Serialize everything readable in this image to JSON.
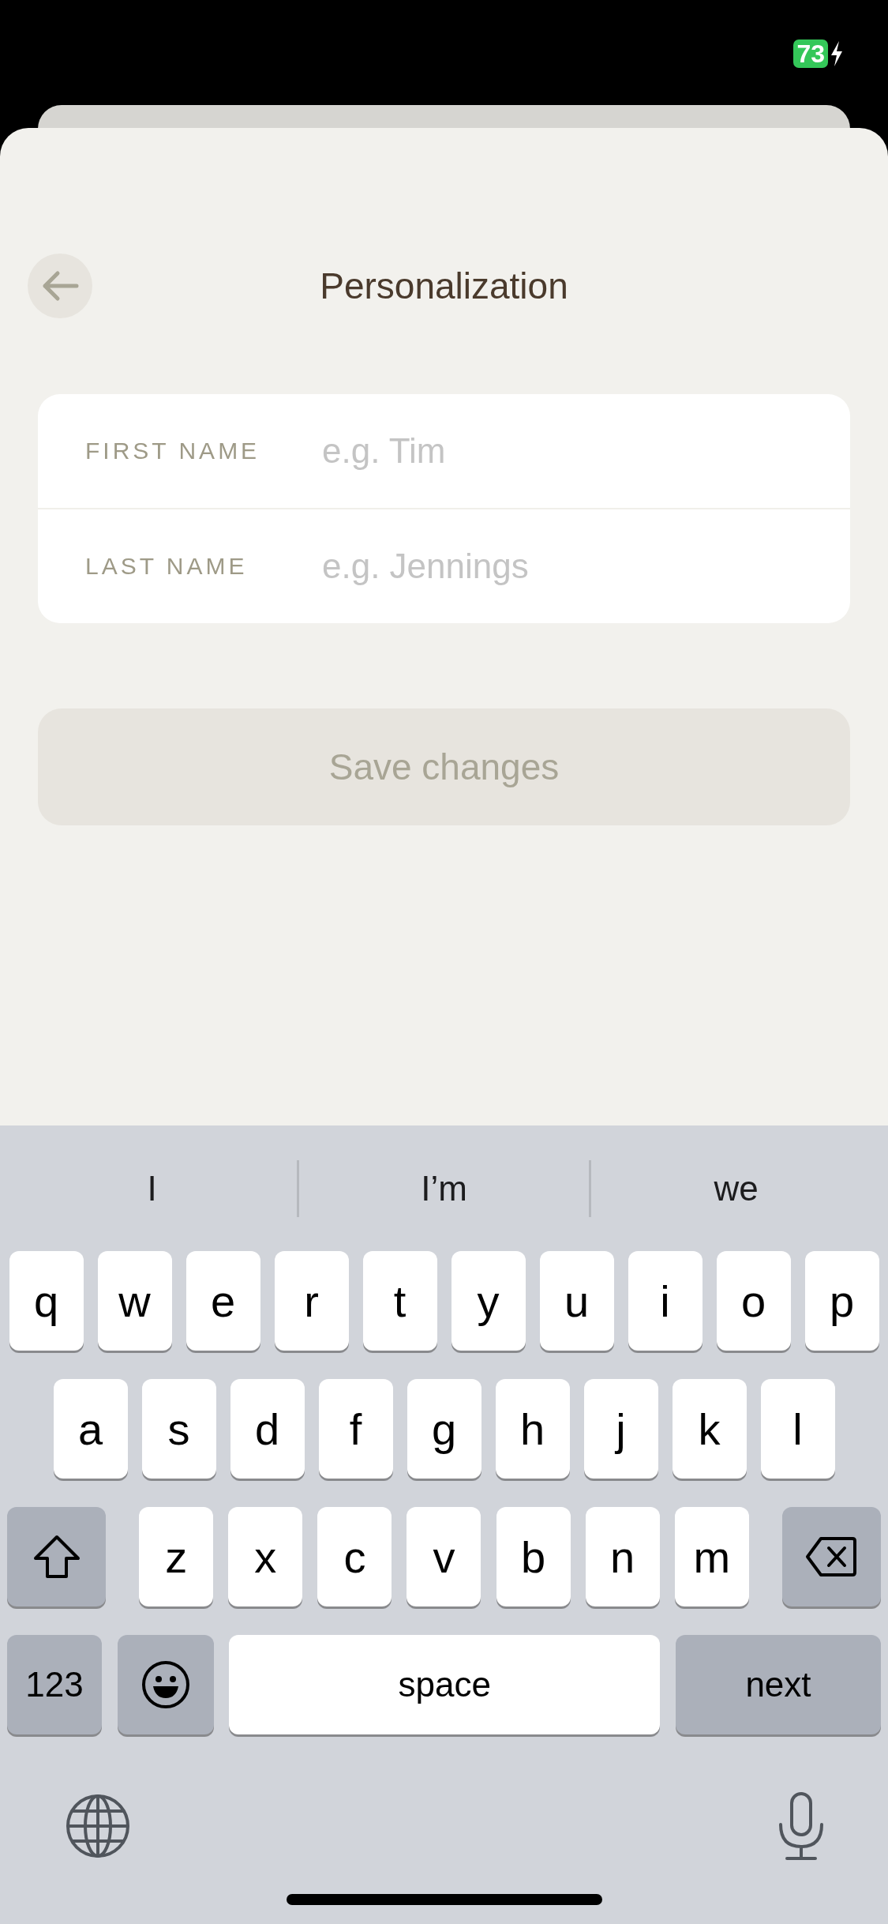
{
  "status_bar": {
    "battery": "73",
    "charging": true
  },
  "header": {
    "title": "Personalization"
  },
  "form": {
    "fields": [
      {
        "label": "FIRST NAME",
        "placeholder": "e.g. Tim"
      },
      {
        "label": "LAST NAME",
        "placeholder": "e.g. Jennings"
      }
    ]
  },
  "save_button": {
    "label": "Save changes",
    "disabled": true
  },
  "keyboard": {
    "suggestions": [
      "I",
      "I’m",
      "we"
    ],
    "top_row": [
      {
        "kind": "letter",
        "label": "q"
      },
      {
        "kind": "letter",
        "label": "w"
      },
      {
        "kind": "letter",
        "label": "e"
      },
      {
        "kind": "letter",
        "label": "r"
      },
      {
        "kind": "letter",
        "label": "t"
      },
      {
        "kind": "letter",
        "label": "y"
      },
      {
        "kind": "letter",
        "label": "u"
      },
      {
        "kind": "letter",
        "label": "i"
      },
      {
        "kind": "letter",
        "label": "o"
      },
      {
        "kind": "letter",
        "label": "p"
      }
    ],
    "middle_row": [
      {
        "kind": "letter",
        "label": "a"
      },
      {
        "kind": "letter",
        "label": "s"
      },
      {
        "kind": "letter",
        "label": "d"
      },
      {
        "kind": "letter",
        "label": "f"
      },
      {
        "kind": "letter",
        "label": "g"
      },
      {
        "kind": "letter",
        "label": "h"
      },
      {
        "kind": "letter",
        "label": "j"
      },
      {
        "kind": "letter",
        "label": "k"
      },
      {
        "kind": "letter",
        "label": "l"
      }
    ],
    "bottom_row": [
      {
        "kind": "shift"
      },
      {
        "kind": "letter",
        "label": "z"
      },
      {
        "kind": "letter",
        "label": "x"
      },
      {
        "kind": "letter",
        "label": "c"
      },
      {
        "kind": "letter",
        "label": "v"
      },
      {
        "kind": "letter",
        "label": "b"
      },
      {
        "kind": "letter",
        "label": "n"
      },
      {
        "kind": "letter",
        "label": "m"
      },
      {
        "kind": "delete"
      }
    ],
    "function_row": {
      "numbers_key": "123",
      "space_key": "space",
      "return_key": "next"
    }
  }
}
